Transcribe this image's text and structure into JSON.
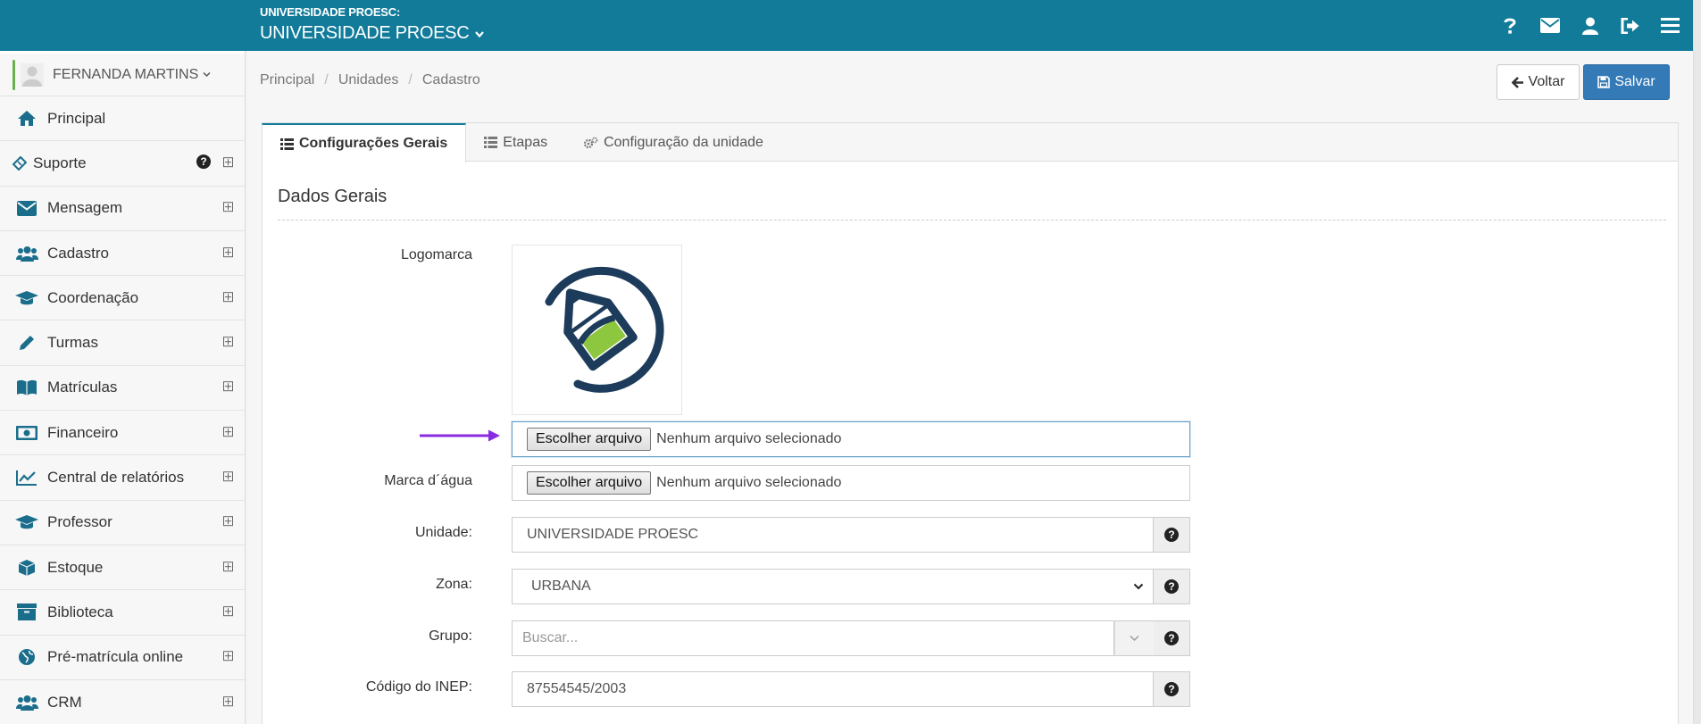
{
  "header": {
    "org_label": "UNIVERSIDADE PROESC:",
    "org_name": "UNIVERSIDADE PROESC",
    "icons": [
      "question-icon",
      "envelope-icon",
      "user-icon",
      "sign-out-icon",
      "menu-icon"
    ],
    "color": "#127b9a"
  },
  "sidebar": {
    "user_name": "FERNANDA MARTINS",
    "items": [
      {
        "label": "Principal",
        "icon": "home-icon"
      },
      {
        "label": "Suporte",
        "icon": "ticket-icon"
      },
      {
        "label": "Mensagem",
        "icon": "envelope-icon"
      },
      {
        "label": "Cadastro",
        "icon": "users-icon"
      },
      {
        "label": "Coordenação",
        "icon": "graduation-cap-icon"
      },
      {
        "label": "Turmas",
        "icon": "pencil-icon"
      },
      {
        "label": "Matrículas",
        "icon": "book-icon"
      },
      {
        "label": "Financeiro",
        "icon": "money-icon"
      },
      {
        "label": "Central de relatórios",
        "icon": "line-chart-icon"
      },
      {
        "label": "Professor",
        "icon": "graduation-cap-icon"
      },
      {
        "label": "Estoque",
        "icon": "cube-icon"
      },
      {
        "label": "Biblioteca",
        "icon": "archive-icon"
      },
      {
        "label": "Pré-matrícula online",
        "icon": "globe-icon"
      },
      {
        "label": "CRM",
        "icon": "users-icon"
      }
    ]
  },
  "breadcrumb": [
    "Principal",
    "Unidades",
    "Cadastro"
  ],
  "actions": {
    "back_label": "Voltar",
    "save_label": "Salvar"
  },
  "tabs": [
    {
      "label": "Configurações Gerais",
      "active": true
    },
    {
      "label": "Etapas",
      "active": false
    },
    {
      "label": "Configuração da unidade",
      "active": false
    }
  ],
  "form": {
    "section_title": "Dados Gerais",
    "logo_label": "Logomarca",
    "file_button": "Escolher arquivo",
    "file_empty": "Nenhum arquivo selecionado",
    "watermark_label": "Marca d´água",
    "unit_label": "Unidade:",
    "unit_value": "UNIVERSIDADE PROESC",
    "zone_label": "Zona:",
    "zone_value": "URBANA",
    "group_label": "Grupo:",
    "group_placeholder": "Buscar...",
    "inep_label": "Código do INEP:",
    "inep_value": "87554545/2003"
  },
  "annotation": {
    "arrow_color": "#8a2be2"
  }
}
